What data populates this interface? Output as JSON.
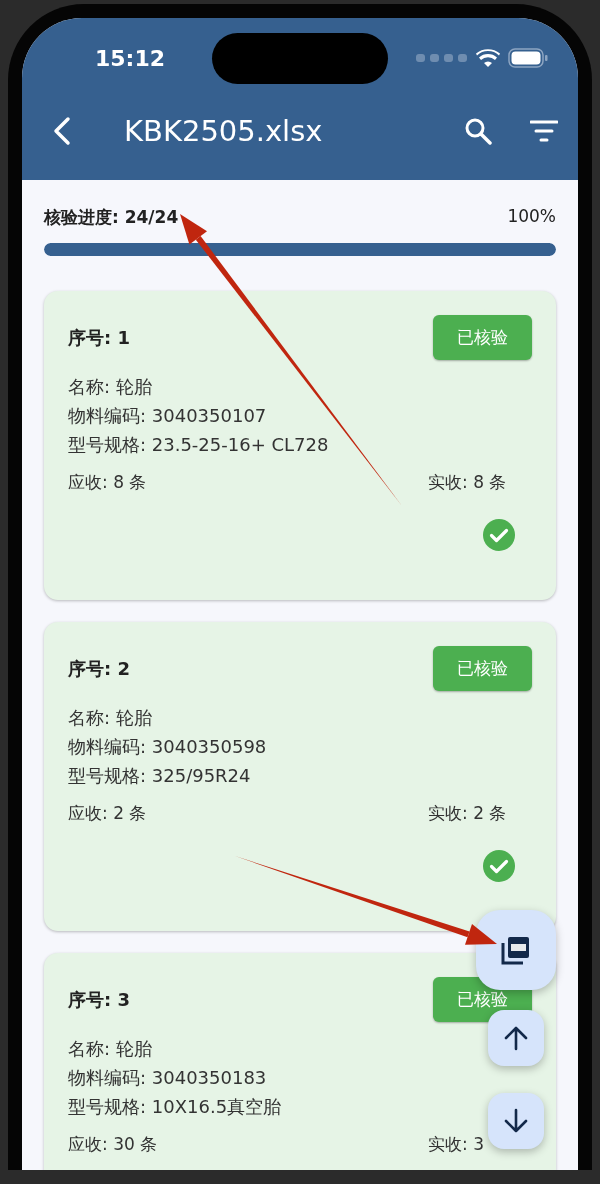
{
  "status_bar": {
    "time": "15:12"
  },
  "app_bar": {
    "title": "KBK2505.xlsx"
  },
  "progress": {
    "label": "核验进度: 24/24",
    "percent": "100%",
    "level": 1
  },
  "items": [
    {
      "number_label": "序号: 1",
      "badge": "已核验",
      "name": "名称: 轮胎",
      "code": "物料编码: 3040350107",
      "spec": "型号规格: 23.5-25-16+ CL728",
      "expected": "应收: 8 条",
      "received": "实收: 8 条",
      "verified": true
    },
    {
      "number_label": "序号: 2",
      "badge": "已核验",
      "name": "名称: 轮胎",
      "code": "物料编码: 3040350598",
      "spec": "型号规格: 325/95R24",
      "expected": "应收: 2 条",
      "received": "实收: 2 条",
      "verified": true
    },
    {
      "number_label": "序号: 3",
      "badge": "已核验",
      "name": "名称: 轮胎",
      "code": "物料编码: 3040350183",
      "spec": "型号规格: 10X16.5真空胎",
      "expected": "应收: 30 条",
      "received": "实收: 3"
    }
  ]
}
